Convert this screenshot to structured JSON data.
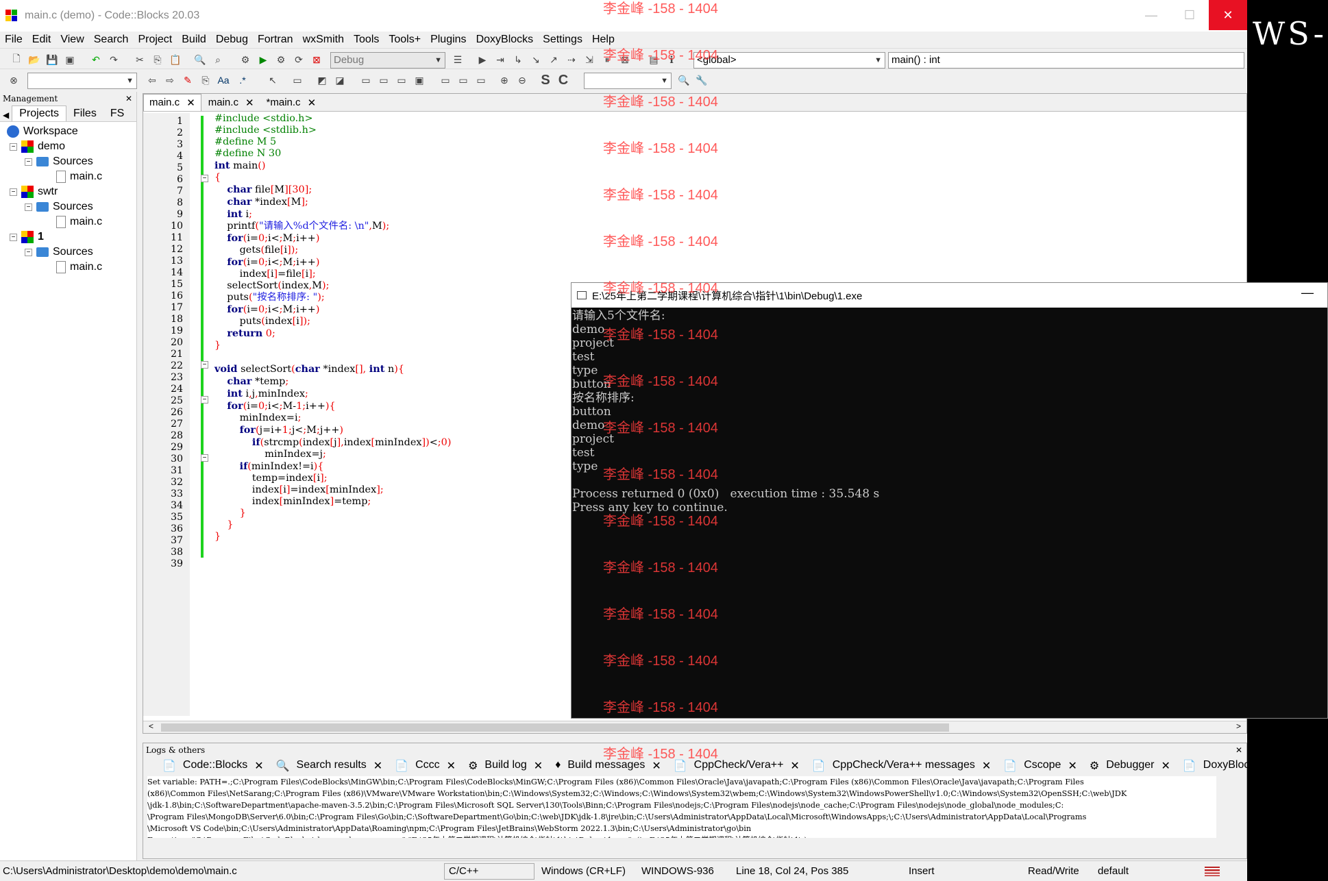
{
  "window": {
    "title": "main.c (demo) - Code::Blocks 20.03",
    "min": "—",
    "max": "☐",
    "close": "✕"
  },
  "menu": [
    "File",
    "Edit",
    "View",
    "Search",
    "Project",
    "Build",
    "Debug",
    "Fortran",
    "wxSmith",
    "Tools",
    "Tools+",
    "Plugins",
    "DoxyBlocks",
    "Settings",
    "Help"
  ],
  "toolbar": {
    "build_target": "Debug",
    "scope": "<global>",
    "symbol": "main() : int"
  },
  "management": {
    "title": "Management",
    "tabs": [
      "Projects",
      "Files",
      "FS"
    ],
    "workspace": "Workspace",
    "tree": [
      {
        "project": "demo",
        "folder": "Sources",
        "file": "main.c"
      },
      {
        "project": "swtr",
        "folder": "Sources",
        "file": "main.c"
      },
      {
        "project": "1",
        "folder": "Sources",
        "file": "main.c"
      }
    ]
  },
  "editor": {
    "tabs": [
      "main.c",
      "main.c",
      "*main.c"
    ],
    "lines": [
      "1",
      "2",
      "3",
      "4",
      "5",
      "6",
      "7",
      "8",
      "9",
      "10",
      "11",
      "12",
      "13",
      "14",
      "15",
      "16",
      "17",
      "18",
      "19",
      "20",
      "21",
      "22",
      "23",
      "24",
      "25",
      "26",
      "27",
      "28",
      "29",
      "30",
      "31",
      "32",
      "33",
      "34",
      "35",
      "36",
      "37",
      "38",
      "39"
    ],
    "code": [
      "#include <stdio.h>",
      "#include <stdlib.h>",
      "#define M 5",
      "#define N 30",
      "int main()",
      "{",
      "    char file[M][30];",
      "    char *index[M];",
      "    int i;",
      "    printf(\"请输入%d个文件名: \\n\",M);",
      "    for(i=0;i<M;i++)",
      "        gets(file[i]);",
      "    for(i=0;i<M;i++)",
      "        index[i]=file[i];",
      "    selectSort(index,M);",
      "    puts(\"按名称排序: \");",
      "    for(i=0;i<M;i++)",
      "        puts(index[i]);",
      "    return 0;",
      "}",
      "",
      "void selectSort(char *index[], int n){",
      "    char *temp;",
      "    int i,j,minIndex;",
      "    for(i=0;i<M-1;i++){",
      "        minIndex=i;",
      "        for(j=i+1;j<M;j++)",
      "            if(strcmp(index[j],index[minIndex])<0)",
      "                minIndex=j;",
      "        if(minIndex!=i){",
      "            temp=index[i];",
      "            index[i]=index[minIndex];",
      "            index[minIndex]=temp;",
      "        }",
      "    }",
      "}",
      "",
      "",
      ""
    ]
  },
  "console": {
    "title": "E:\\25年上第二学期课程\\计算机综合\\指针\\1\\bin\\Debug\\1.exe",
    "min": "—",
    "output": "请输入5个文件名:\ndemo\nproject\ntest\ntype\nbutton\n按名称排序:\nbutton\ndemo\nproject\ntest\ntype\n\nProcess returned 0 (0x0)   execution time : 35.548 s\nPress any key to continue."
  },
  "logs": {
    "title": "Logs & others",
    "tabs": [
      "Code::Blocks",
      "Search results",
      "Cccc",
      "Build log",
      "Build messages",
      "CppCheck/Vera++",
      "CppCheck/Vera++ messages",
      "Cscope",
      "Debugger",
      "DoxyBlocks"
    ],
    "text": "Set variable: PATH=.;C:\\Program Files\\CodeBlocks\\MinGW\\bin;C:\\Program Files\\CodeBlocks\\MinGW;C:\\Program Files (x86)\\Common Files\\Oracle\\Java\\javapath;C:\\Program Files (x86)\\Common Files\\Oracle\\Java\\javapath;C:\\Program Files\n(x86)\\Common Files\\NetSarang;C:\\Program Files (x86)\\VMware\\VMware Workstation\\bin;C:\\Windows\\System32;C:\\Windows;C:\\Windows\\System32\\wbem;C:\\Windows\\System32\\WindowsPowerShell\\v1.0;C:\\Windows\\System32\\OpenSSH;C:\\web\\JDK\n\\jdk-1.8\\bin;C:\\SoftwareDepartment\\apache-maven-3.5.2\\bin;C:\\Program Files\\Microsoft SQL Server\\130\\Tools\\Binn;C:\\Program Files\\nodejs;C:\\Program Files\\nodejs\\node_cache;C:\\Program Files\\nodejs\\node_global\\node_modules;C:\n\\Program Files\\MongoDB\\Server\\6.0\\bin;C:\\Program Files\\Go\\bin;C:\\SoftwareDepartment\\Go\\bin;C:\\web\\JDK\\jdk-1.8\\jre\\bin;C:\\Users\\Administrator\\AppData\\Local\\Microsoft\\WindowsApps;\\;C:\\Users\\Administrator\\AppData\\Local\\Programs\n\\Microsoft VS Code\\bin;C:\\Users\\Administrator\\AppData\\Roaming\\npm;C:\\Program Files\\JetBrains\\WebStorm 2022.1.3\\bin;C:\\Users\\Administrator\\go\\bin\nExecuting: \"C:\\Program Files\\CodeBlocks/cb_console_runner.exe\" \"E:\\25年上第二学期课程\\计算机综合\\指针\\1\\bin\\Debug\\1.exe\"  (in E:\\25年上第二学期课程\\计算机综合\\指针\\1\\.)"
  },
  "status": {
    "path": "C:\\Users\\Administrator\\Desktop\\demo\\demo\\main.c",
    "lang": "C/C++",
    "eol": "Windows (CR+LF)",
    "enc": "WINDOWS-936",
    "pos": "Line 18, Col 24, Pos 385",
    "mode": "Insert",
    "rw": "Read/Write",
    "prof": "default"
  },
  "watermark": "李金峰 -158 - 1404",
  "side_logo": "WS-"
}
